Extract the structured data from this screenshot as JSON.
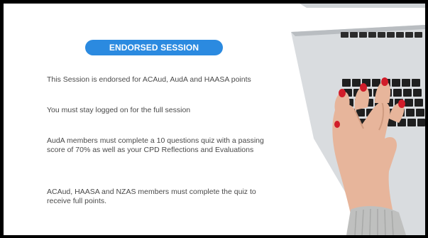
{
  "badge": "ENDORSED SESSION",
  "paragraphs": [
    "This Session is endorsed for ACAud, AudA and HAASA points",
    "You must stay logged on for the full session",
    "AudA members must complete a 10 questions quiz with a passing score of 70% as well as your CPD Reflections and Evaluations",
    "ACAud, HAASA and NZAS members must complete the quiz to receive full points."
  ],
  "colors": {
    "badge_bg": "#2b8ae0",
    "text": "#4a4a4a",
    "frame": "#000000"
  },
  "image": "hand-typing-on-laptop-keyboard"
}
